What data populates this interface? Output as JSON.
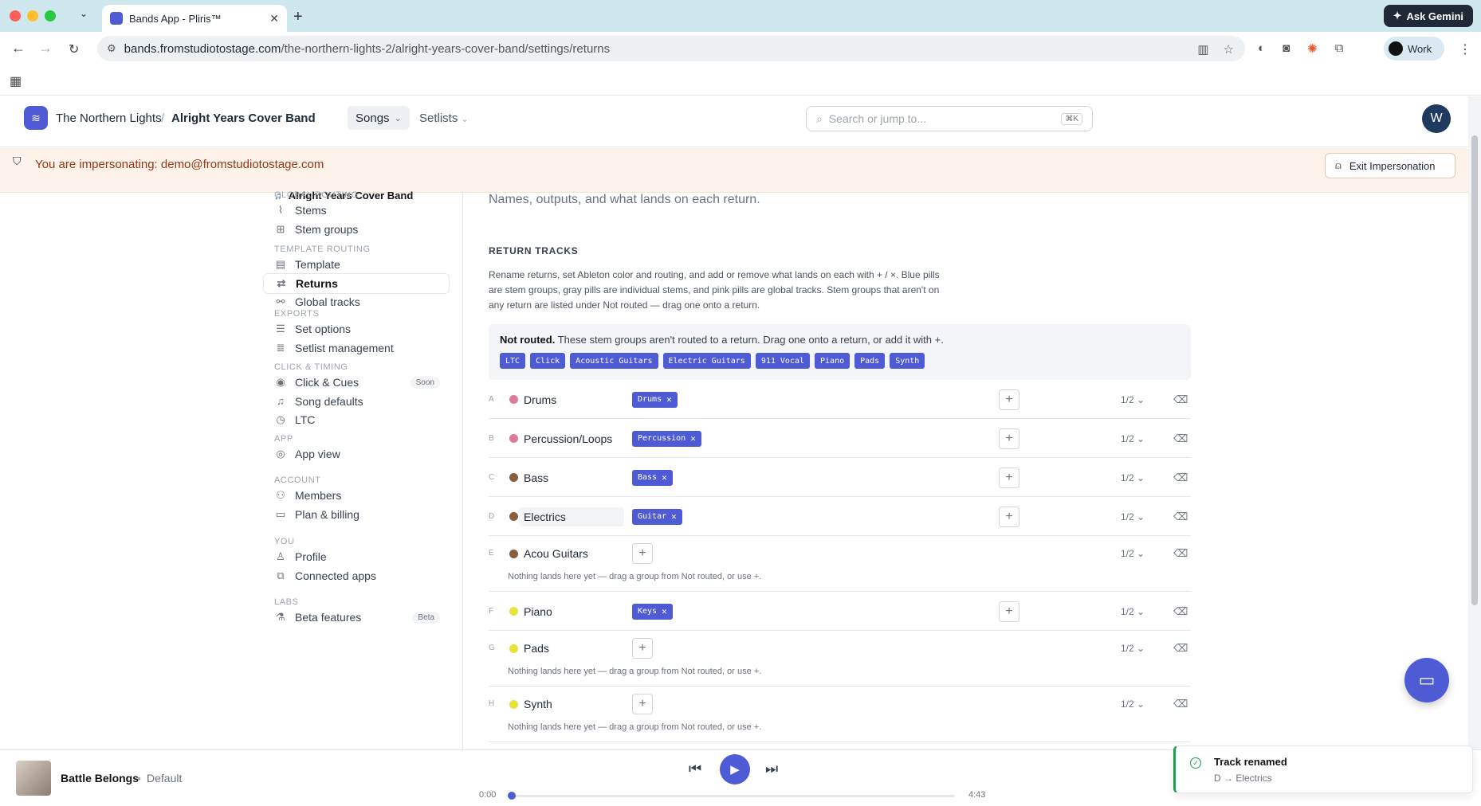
{
  "browser": {
    "tab_title": "Bands App - Pliris™",
    "url_host": "bands.fromstudiotostage.com",
    "url_path": "/the-northern-lights-2/alright-years-cover-band/settings/returns",
    "gemini_label": "Ask Gemini",
    "profile_label": "Work"
  },
  "header": {
    "org": "The Northern Lights",
    "separator": "/",
    "band": "Alright Years Cover Band",
    "nav_songs": "Songs",
    "nav_setlists": "Setlists",
    "search_placeholder": "Search or jump to...",
    "search_shortcut": "⌘K",
    "avatar_initial": "W"
  },
  "impersonation": {
    "text": "You are impersonating: demo@fromstudiotostage.com",
    "exit_label": "Exit Impersonation"
  },
  "sidebar": {
    "band_selector": "Alright Years Cover Band",
    "sections": [
      {
        "title": "GLOBAL ROUTING",
        "items": [
          {
            "label": "Stems",
            "icon": "waveform-icon"
          },
          {
            "label": "Stem groups",
            "icon": "grid-icon"
          }
        ]
      },
      {
        "title": "TEMPLATE ROUTING",
        "items": [
          {
            "label": "Template",
            "icon": "layout-icon"
          },
          {
            "label": "Returns",
            "icon": "refresh-icon",
            "active": true
          },
          {
            "label": "Global tracks",
            "icon": "share-icon"
          }
        ]
      },
      {
        "title": "EXPORTS",
        "items": [
          {
            "label": "Set options",
            "icon": "sliders-icon"
          },
          {
            "label": "Setlist management",
            "icon": "list-icon"
          }
        ]
      },
      {
        "title": "CLICK & TIMING",
        "items": [
          {
            "label": "Click & Cues",
            "icon": "broadcast-icon",
            "badge": "Soon"
          },
          {
            "label": "Song defaults",
            "icon": "music-note-icon"
          },
          {
            "label": "LTC",
            "icon": "timer-icon"
          }
        ]
      },
      {
        "title": "APP",
        "items": [
          {
            "label": "App view",
            "icon": "eye-icon"
          }
        ]
      },
      {
        "title": "ACCOUNT",
        "items": [
          {
            "label": "Members",
            "icon": "users-icon"
          },
          {
            "label": "Plan & billing",
            "icon": "card-icon"
          }
        ]
      },
      {
        "title": "YOU",
        "items": [
          {
            "label": "Profile",
            "icon": "user-icon"
          },
          {
            "label": "Connected apps",
            "icon": "apps-icon"
          }
        ]
      },
      {
        "title": "LABS",
        "items": [
          {
            "label": "Beta features",
            "icon": "flask-icon",
            "badge": "Beta"
          }
        ]
      }
    ]
  },
  "main": {
    "subtitle": "Names, outputs, and what lands on each return.",
    "heading": "RETURN TRACKS",
    "description": "Rename returns, set Ableton color and routing, and add or remove what lands on each with + / ×. Blue pills are stem groups, gray pills are individual stems, and pink pills are global tracks. Stem groups that aren't on any return are listed under Not routed — drag one onto a return.",
    "not_routed_title": "Not routed.",
    "not_routed_text": "These stem groups aren't routed to a return. Drag one onto a return, or add it with +.",
    "not_routed_pills": [
      "LTC",
      "Click",
      "Acoustic Guitars",
      "Electric Guitars",
      "911 Vocal",
      "Piano",
      "Pads",
      "Synth"
    ],
    "empty_hint": "Nothing lands here yet — drag a group from Not routed, or use +.",
    "returns": [
      {
        "letter": "A",
        "name": "Drums",
        "color": "#e07a9a",
        "pills": [
          "Drums"
        ],
        "ratio": "1/2"
      },
      {
        "letter": "B",
        "name": "Percussion/Loops",
        "color": "#e07a9a",
        "pills": [
          "Percussion"
        ],
        "ratio": "1/2"
      },
      {
        "letter": "C",
        "name": "Bass",
        "color": "#8b5e3c",
        "pills": [
          "Bass"
        ],
        "ratio": "1/2"
      },
      {
        "letter": "D",
        "name": "Electrics",
        "color": "#8b5e3c",
        "pills": [
          "Guitar"
        ],
        "ratio": "1/2",
        "editing": true
      },
      {
        "letter": "E",
        "name": "Acou Guitars",
        "color": "#8b5e3c",
        "pills": [],
        "ratio": "1/2"
      },
      {
        "letter": "F",
        "name": "Piano",
        "color": "#e8e33a",
        "pills": [
          "Keys"
        ],
        "ratio": "1/2"
      },
      {
        "letter": "G",
        "name": "Pads",
        "color": "#e8e33a",
        "pills": [],
        "ratio": "1/2"
      },
      {
        "letter": "H",
        "name": "Synth",
        "color": "#e8e33a",
        "pills": [],
        "ratio": "1/2"
      }
    ]
  },
  "player": {
    "title": "Battle Belongs",
    "dot": "•",
    "subtitle": "Default",
    "time_current": "0:00",
    "time_total": "4:43",
    "progress": 0
  },
  "toast": {
    "title": "Track renamed",
    "detail": "D → Electrics"
  }
}
